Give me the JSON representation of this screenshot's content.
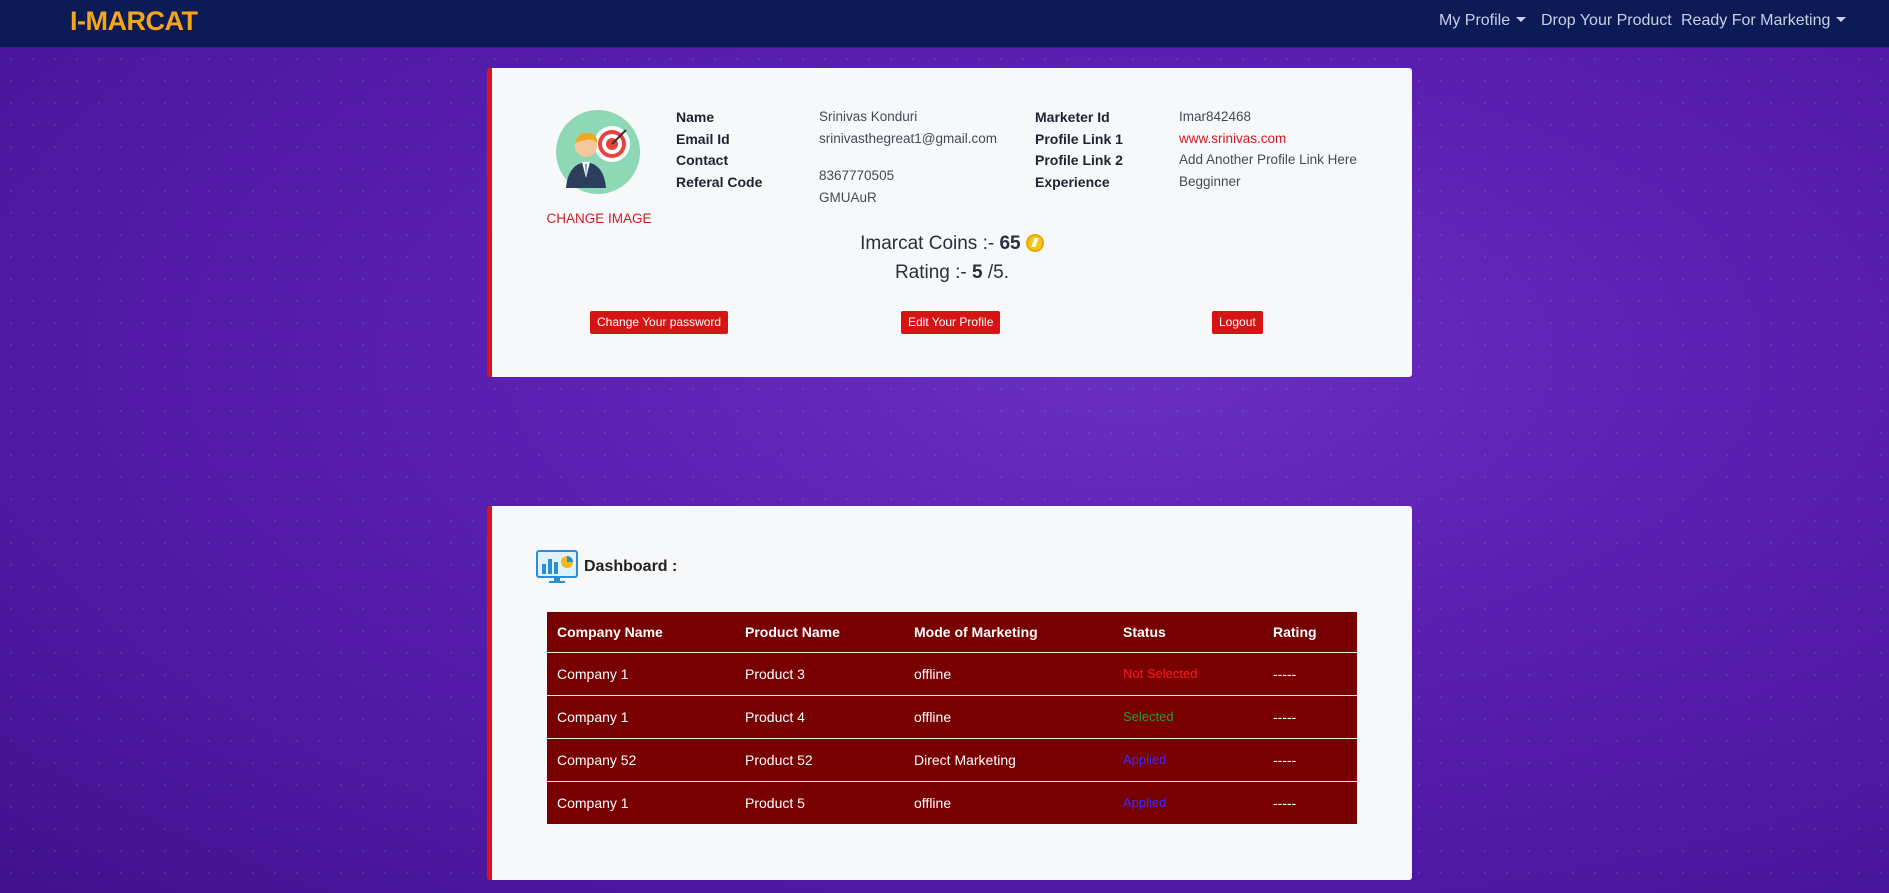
{
  "navbar": {
    "brand": "I-MARCAT",
    "my_profile": "My Profile",
    "drop_product": "Drop Your Product",
    "ready_marketing": "Ready For Marketing"
  },
  "profile": {
    "change_image": "CHANGE IMAGE",
    "fields_left": [
      {
        "label": "Name",
        "value": "Srinivas Konduri"
      },
      {
        "label": "Email Id",
        "value": "srinivasthegreat1@gmail.com"
      },
      {
        "label": "Contact",
        "value": "8367770505"
      },
      {
        "label": "Referal Code",
        "value": "GMUAuR"
      }
    ],
    "fields_right": [
      {
        "label": "Marketer Id",
        "value": "Imar842468"
      },
      {
        "label": "Profile Link 1",
        "value": "www.srinivas.com"
      },
      {
        "label": "Profile Link 2",
        "value": "Add Another Profile Link Here"
      },
      {
        "label": "Experience",
        "value": "Begginner"
      }
    ],
    "coins_label": "Imarcat Coins :-",
    "coins_value": "65",
    "rating_label": "Rating :-",
    "rating_value": "5",
    "rating_suffix": "/5.",
    "buttons": {
      "change_password": "Change Your password",
      "edit_profile": "Edit Your Profile",
      "logout": "Logout"
    }
  },
  "dashboard": {
    "title": "Dashboard :",
    "columns": [
      "Company Name",
      "Product Name",
      "Mode of Marketing",
      "Status",
      "Rating"
    ],
    "rows": [
      {
        "company": "Company 1",
        "product": "Product 3",
        "mode": "offline",
        "status": "Not Selected",
        "status_color": "#ff1a1a",
        "rating": "-----"
      },
      {
        "company": "Company 1",
        "product": "Product 4",
        "mode": "offline",
        "status": "Selected",
        "status_color": "#2e9b2e",
        "rating": "-----"
      },
      {
        "company": "Company 52",
        "product": "Product 52",
        "mode": "Direct Marketing",
        "status": "Applied",
        "status_color": "#3a2bff",
        "rating": "-----"
      },
      {
        "company": "Company 1",
        "product": "Product 5",
        "mode": "offline",
        "status": "Applied",
        "status_color": "#3a2bff",
        "rating": "-----"
      }
    ]
  },
  "colors": {
    "navbar": "#0c1a55",
    "brand": "#f3a51b",
    "accent_red": "#d71414",
    "table_bg": "#780000"
  }
}
